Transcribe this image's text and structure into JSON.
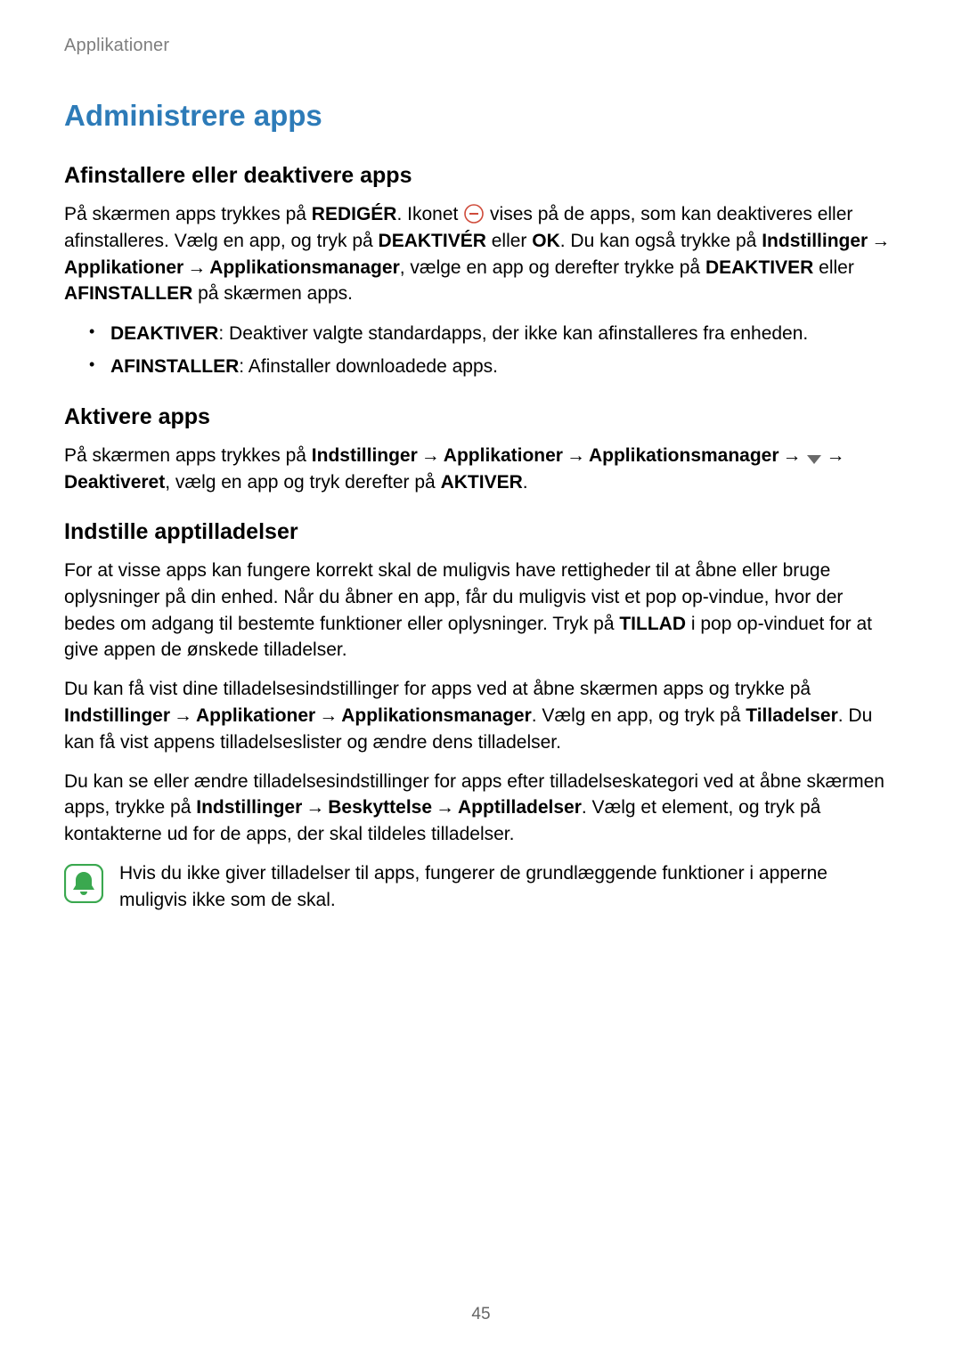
{
  "runhead": "Applikationer",
  "title": "Administrere apps",
  "section1": {
    "heading": "Afinstallere eller deaktivere apps",
    "p1_a": "På skærmen apps trykkes på ",
    "p1_b": "REDIGÉR",
    "p1_c": ". Ikonet ",
    "p1_d": " vises på de apps, som kan deaktiveres eller afinstalleres. Vælg en app, og tryk på ",
    "p1_e": "DEAKTIVÉR",
    "p1_f": " eller ",
    "p1_g": "OK",
    "p1_h": ". Du kan også trykke på ",
    "p1_i": "Indstillinger",
    "p1_j": " → ",
    "p1_k": "Applikationer",
    "p1_l": " → ",
    "p1_m": "Applikationsmanager",
    "p1_n": ", vælge en app og derefter trykke på ",
    "p1_o": "DEAKTIVER",
    "p1_p": " eller ",
    "p1_q": "AFINSTALLER",
    "p1_r": " på skærmen apps.",
    "bullets": [
      {
        "term": "DEAKTIVER",
        "rest": ": Deaktiver valgte standardapps, der ikke kan afinstalleres fra enheden."
      },
      {
        "term": "AFINSTALLER",
        "rest": ": Afinstaller downloadede apps."
      }
    ]
  },
  "section2": {
    "heading": "Aktivere apps",
    "p_a": "På skærmen apps trykkes på ",
    "p_b": "Indstillinger",
    "p_c": " → ",
    "p_d": "Applikationer",
    "p_e": " → ",
    "p_f": "Applikationsmanager",
    "p_g": " → ",
    "p_h": " → ",
    "p_i": "Deaktiveret",
    "p_j": ", vælg en app og tryk derefter på ",
    "p_k": "AKTIVER",
    "p_l": "."
  },
  "section3": {
    "heading": "Indstille apptilladelser",
    "p1_a": "For at visse apps kan fungere korrekt skal de muligvis have rettigheder til at åbne eller bruge oplysninger på din enhed. Når du åbner en app, får du muligvis vist et pop op‑vindue, hvor der bedes om adgang til bestemte funktioner eller oplysninger. Tryk på ",
    "p1_b": "TILLAD",
    "p1_c": " i pop op‑vinduet for at give appen de ønskede tilladelser.",
    "p2_a": "Du kan få vist dine tilladelsesindstillinger for apps ved at åbne skærmen apps og trykke på ",
    "p2_b": "Indstillinger",
    "p2_c": " → ",
    "p2_d": "Applikationer",
    "p2_e": " → ",
    "p2_f": "Applikationsmanager",
    "p2_g": ". Vælg en app, og tryk på ",
    "p2_h": "Tilladelser",
    "p2_i": ". Du kan få vist appens tilladelseslister og ændre dens tilladelser.",
    "p3_a": "Du kan se eller ændre tilladelsesindstillinger for apps efter tilladelseskategori ved at åbne skærmen apps, trykke på ",
    "p3_b": "Indstillinger",
    "p3_c": " → ",
    "p3_d": "Beskyttelse",
    "p3_e": " → ",
    "p3_f": "Apptilladelser",
    "p3_g": ". Vælg et element, og tryk på kontakterne ud for de apps, der skal tildeles tilladelser.",
    "note": "Hvis du ikke giver tilladelser til apps, fungerer de grundlæggende funktioner i apperne muligvis ikke som de skal."
  },
  "page_number": "45"
}
